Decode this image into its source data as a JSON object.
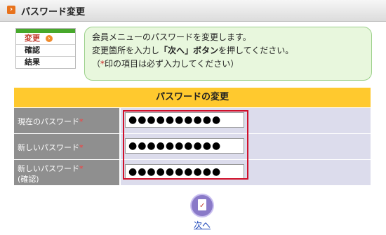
{
  "header": {
    "title": "パスワード変更"
  },
  "steps": [
    {
      "label": "変更"
    },
    {
      "label": "確認"
    },
    {
      "label": "結果"
    }
  ],
  "notice": {
    "line1": "会員メニューのパスワードを変更します。",
    "line2_pre": "変更箇所を入力し",
    "line2_bold": "「次へ」ボタン",
    "line2_post": "を押してください。",
    "line3_pre": "（",
    "line3_star": "*",
    "line3_post": "印の項目は必ず入力してください）"
  },
  "form": {
    "title": "パスワードの変更",
    "fields": [
      {
        "label": "現在のパスワード",
        "value": "●●●●●●●●●●"
      },
      {
        "label": "新しいパスワード",
        "value": "●●●●●●●●●●"
      },
      {
        "label_line1": "新しいパスワード",
        "label_line2": "(確認)",
        "value": "●●●●●●●●●●"
      }
    ],
    "required_mark": "*"
  },
  "next_button": {
    "label": "次へ"
  }
}
